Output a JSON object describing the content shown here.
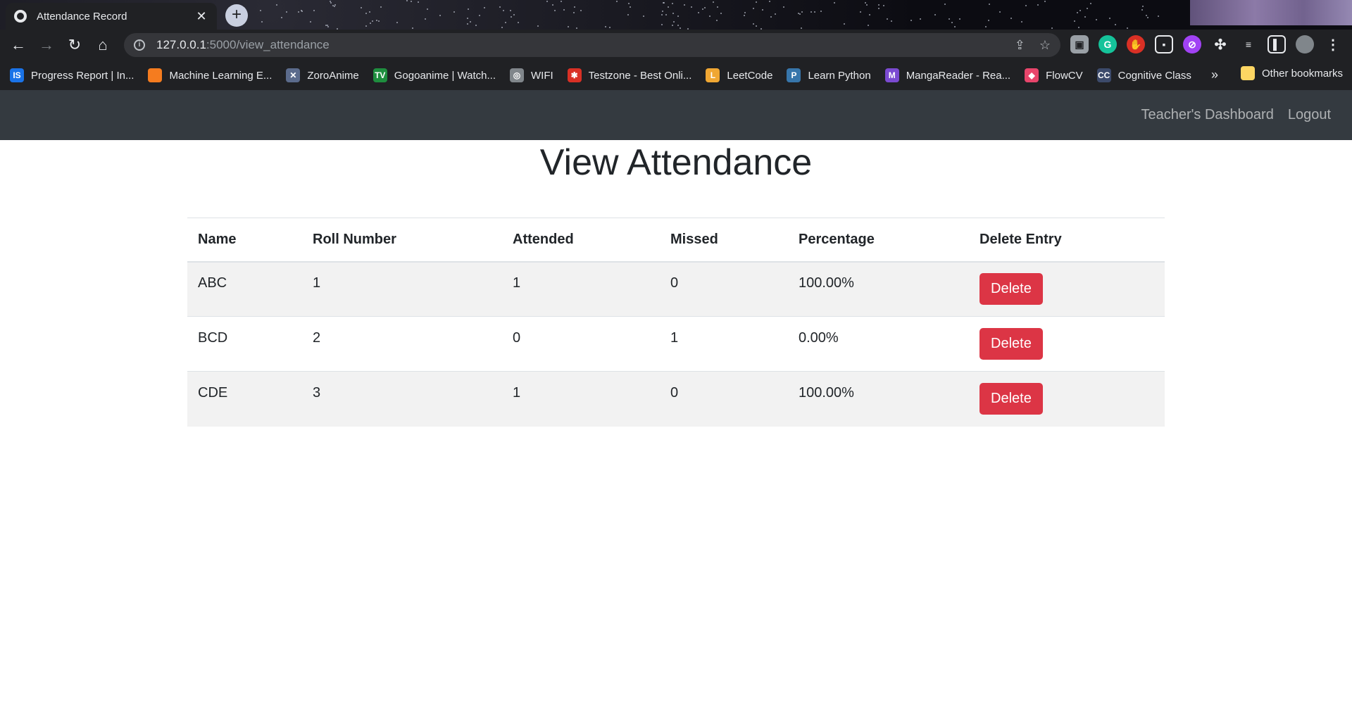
{
  "browser": {
    "tab_title": "Attendance Record",
    "url_host": "127.0.0.1",
    "url_path": ":5000/view_attendance",
    "bookmarks": [
      {
        "label": "Progress Report | In...",
        "color": "#1a73e8",
        "glyph": "IS"
      },
      {
        "label": "Machine Learning E...",
        "color": "#f57c1f",
        "glyph": ""
      },
      {
        "label": "ZoroAnime",
        "color": "#5b6b8c",
        "glyph": "✕"
      },
      {
        "label": "Gogoanime | Watch...",
        "color": "#1e8e3e",
        "glyph": "TV"
      },
      {
        "label": "WIFI",
        "color": "#80868b",
        "glyph": "◎"
      },
      {
        "label": "Testzone - Best Onli...",
        "color": "#d93025",
        "glyph": "✱"
      },
      {
        "label": "LeetCode",
        "color": "#f0a733",
        "glyph": "L"
      },
      {
        "label": "Learn Python",
        "color": "#3776ab",
        "glyph": "P"
      },
      {
        "label": "MangaReader - Rea...",
        "color": "#7b4ad1",
        "glyph": "M"
      },
      {
        "label": "FlowCV",
        "color": "#e8456b",
        "glyph": "◆"
      },
      {
        "label": "Cognitive Class",
        "color": "#3c4a6b",
        "glyph": "CC"
      }
    ],
    "more_bookmarks": "»",
    "other_bookmarks": "Other bookmarks"
  },
  "nav": {
    "dashboard": "Teacher's Dashboard",
    "logout": "Logout"
  },
  "page": {
    "title": "View Attendance"
  },
  "table": {
    "headers": [
      "Name",
      "Roll Number",
      "Attended",
      "Missed",
      "Percentage",
      "Delete Entry"
    ],
    "rows": [
      {
        "name": "ABC",
        "roll": "1",
        "attended": "1",
        "missed": "0",
        "percentage": "100.00%"
      },
      {
        "name": "BCD",
        "roll": "2",
        "attended": "0",
        "missed": "1",
        "percentage": "0.00%"
      },
      {
        "name": "CDE",
        "roll": "3",
        "attended": "1",
        "missed": "0",
        "percentage": "100.00%"
      }
    ],
    "delete_label": "Delete"
  },
  "colors": {
    "navbar": "#343a40",
    "danger": "#dc3545",
    "stripe": "#f2f2f2"
  }
}
